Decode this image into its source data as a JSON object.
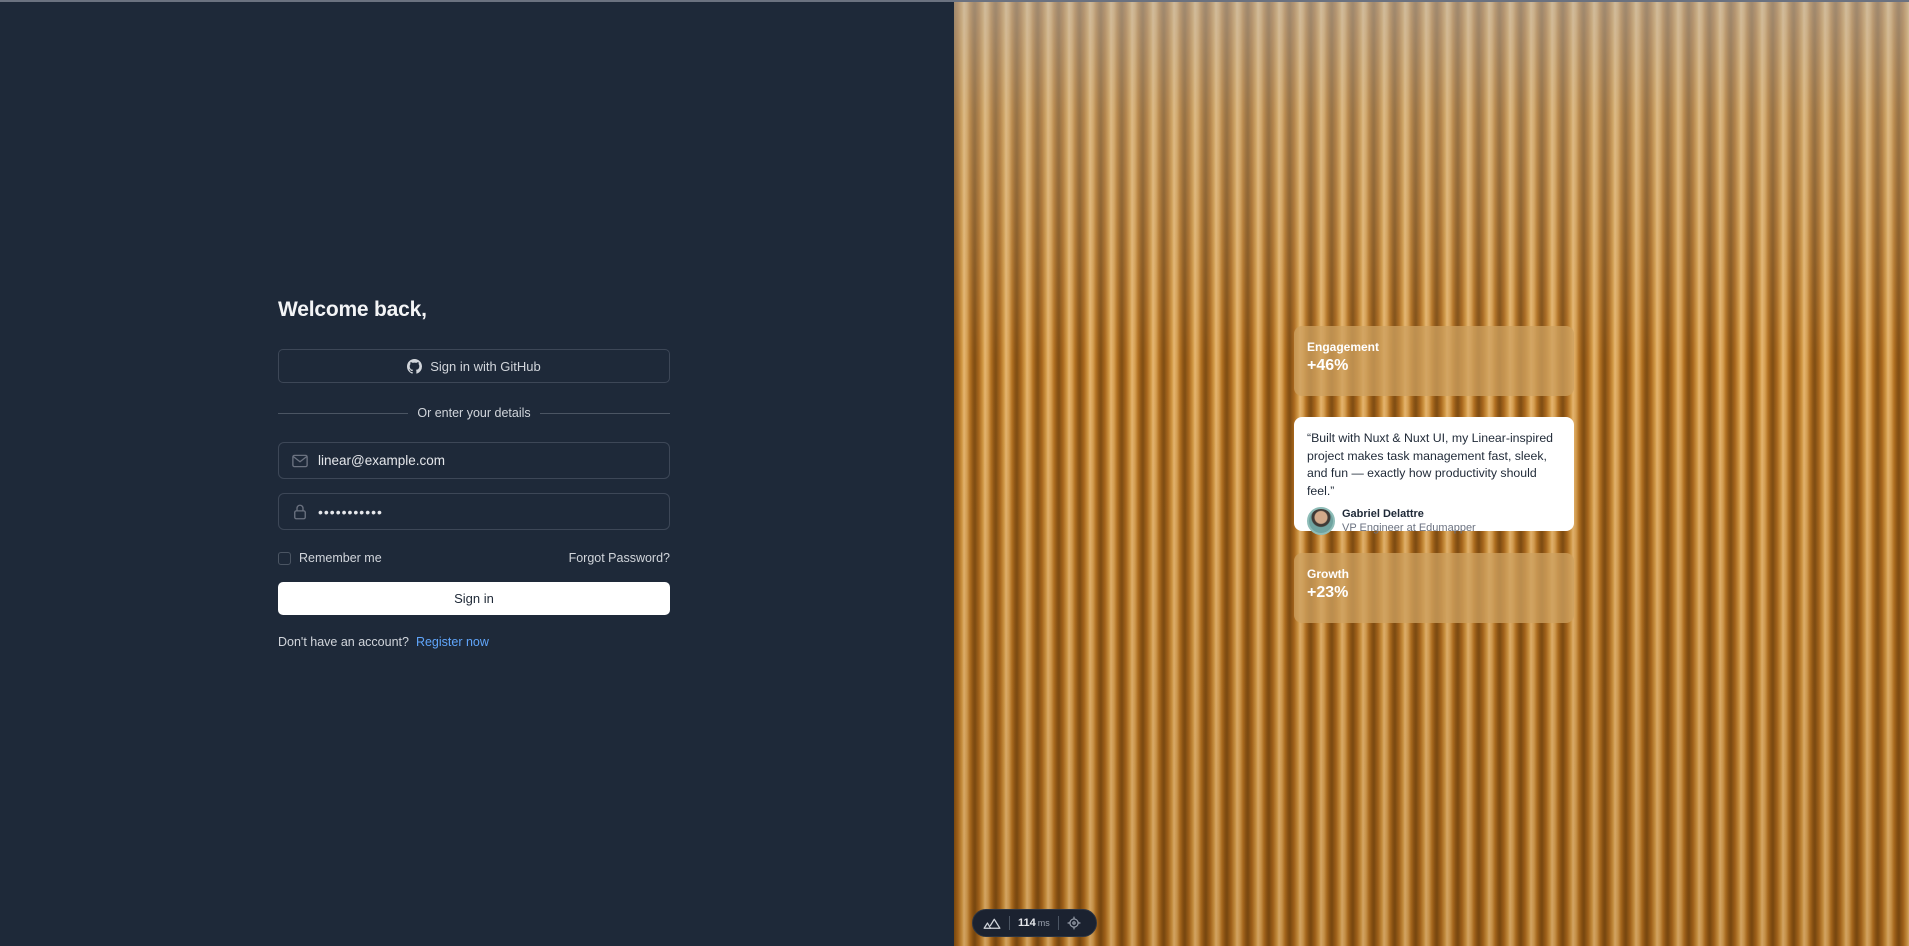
{
  "login": {
    "title": "Welcome back,",
    "github_label": "Sign in with GitHub",
    "divider_text": "Or enter your details",
    "email_value": "linear@example.com",
    "password_value": "•••••••••••",
    "remember_label": "Remember me",
    "forgot_label": "Forgot Password?",
    "signin_label": "Sign in",
    "no_account_text": "Don't have an account?",
    "register_label": "Register now"
  },
  "showcase": {
    "engagement": {
      "label": "Engagement",
      "value": "+46%"
    },
    "testimonial": {
      "quote": "“Built with Nuxt & Nuxt UI, my Linear-inspired project makes task management fast, sleek, and fun — exactly how productivity should feel.”",
      "author_name": "Gabriel Delattre",
      "author_role": "VP Engineer at Edumapper"
    },
    "growth": {
      "label": "Growth",
      "value": "+23%"
    }
  },
  "devtools": {
    "response_time": "114",
    "unit": "ms"
  },
  "colors": {
    "background": "#1e2939",
    "accent_link": "#60a5fa",
    "button_bg": "#ffffff"
  }
}
